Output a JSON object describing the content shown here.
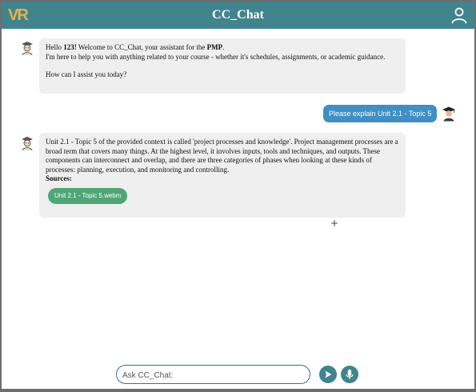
{
  "header": {
    "logo_text": "VR",
    "title": "CC_Chat",
    "user_icon": "user-icon"
  },
  "messages": {
    "welcome": {
      "greeting_prefix": "Hello ",
      "username": "123!",
      "greeting_mid": " Welcome to CC_Chat, your assistant for the ",
      "course": "PMP",
      "greeting_end": ".",
      "line2": "I'm here to help you with anything related to your course - whether it's schedules, assignments, or academic guidance.",
      "question": "How can I assist you today?"
    },
    "user_question": "Please explain Unit 2.1 - Topic 5",
    "answer": {
      "text": "Unit 2.1 - Topic 5 of the provided context is called 'project processes and knowledge'. Project management processes are a broad term that covers many things. At the highest level, it involves inputs, tools and techniques, and outputs. These components can interconnect and overlap, and there are three categories of phases when looking at these kinds of processes: planning, execution, and monitoring and controlling.",
      "sources_label": "Sources:",
      "sources": [
        "Unit 2.1 - Topic 5.webm"
      ]
    }
  },
  "composer": {
    "placeholder": "Ask CC_Chat:",
    "add_symbol": "+",
    "send_icon": "send-icon",
    "mic_icon": "microphone-icon"
  },
  "colors": {
    "header": "#40848d",
    "logo": "#e6b24a",
    "user_bubble": "#3f8fc4",
    "bot_bubble": "#efefef",
    "source_chip": "#4fa676"
  }
}
